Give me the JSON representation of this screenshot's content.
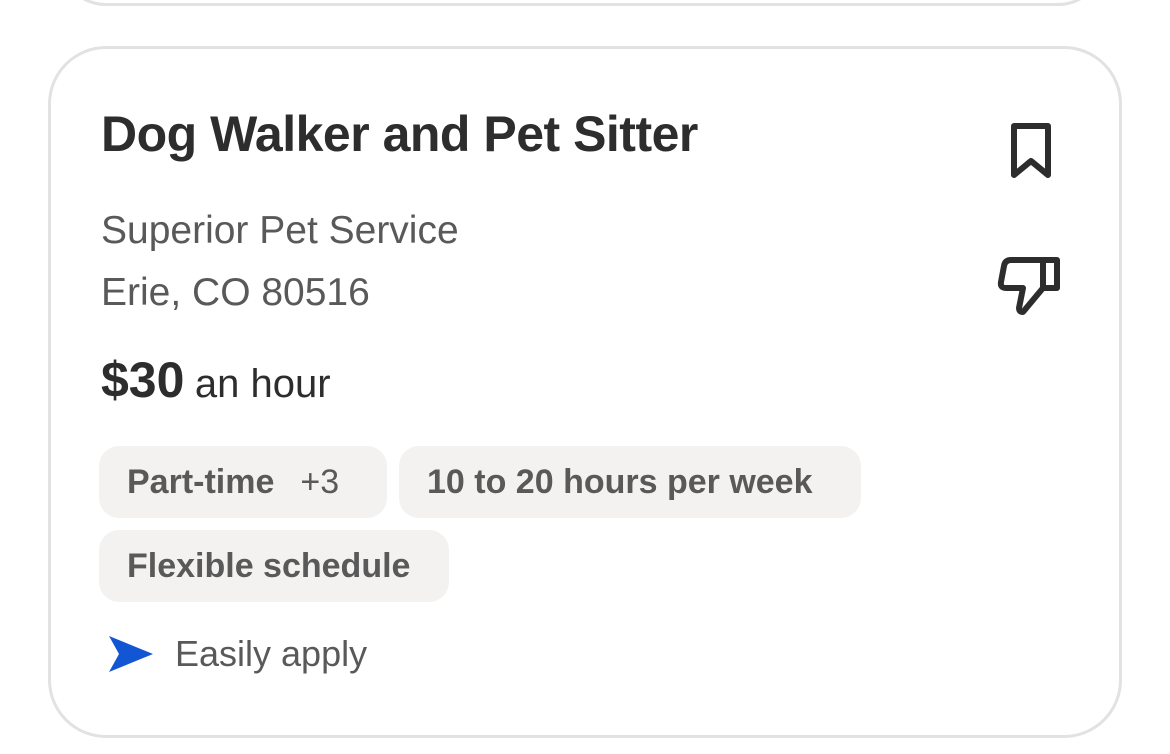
{
  "job": {
    "title": "Dog Walker and Pet Sitter",
    "company": "Superior Pet Service",
    "location": "Erie, CO 80516",
    "salary": {
      "amount": "$30",
      "period": "an hour"
    },
    "tags": [
      {
        "label": "Part-time",
        "more": "+3"
      },
      {
        "label": "10 to 20 hours per week"
      },
      {
        "label": "Flexible schedule"
      }
    ],
    "easily_apply_label": "Easily apply"
  },
  "icons": {
    "save": "bookmark-icon",
    "dislike": "thumbs-down-icon",
    "easily_apply": "send-arrow-icon"
  },
  "colors": {
    "title_text": "#2d2d2d",
    "secondary_text": "#595959",
    "tag_background": "#f3f2f1",
    "card_border": "#e4e2e0",
    "accent_blue": "#1356d3"
  }
}
